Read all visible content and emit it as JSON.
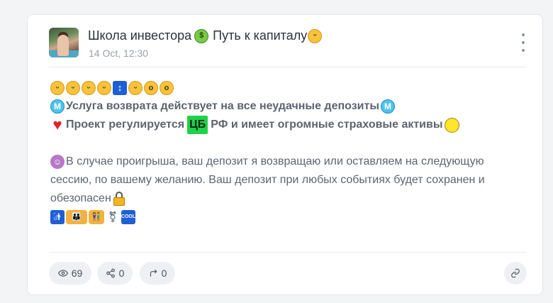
{
  "post": {
    "channel_title": "Школа инвестора 🤑 Путь к капиталу😋",
    "channel_title_text": "Школа инвестора",
    "channel_title_text2": "Путь к капиталу",
    "timestamp": "14 Oct, 12:30",
    "avatar_icon": "avatar-photo",
    "menu_icon": "more-vertical-icon"
  },
  "content": {
    "line1_emojis": [
      "😀",
      "😃",
      "😁",
      "🙂",
      "↕",
      "😋",
      "😮",
      "😦"
    ],
    "line2_text": "Услуга возврата действует на все неудачные депозиты",
    "line3_text_before": "Проект регулируется",
    "line3_highlight": "ЦБ",
    "line3_text_after": "РФ и имеет огромные страховые активы",
    "para1": "В случае проигрыша, ваш депозит я возвращаю или оставляем на следующую сессию, по вашему желанию. Ваш депозит при любых событиях будет сохранен и обезопасен",
    "last_line_emojis": [
      "🚮",
      "👨‍👩‍👧",
      "👫",
      "⚧",
      "🆒"
    ],
    "highlight_color": "#21d04b"
  },
  "footer": {
    "views": "69",
    "shares": "0",
    "forwards": "0",
    "views_icon": "eye-icon",
    "shares_icon": "share-nodes-icon",
    "forwards_icon": "forward-arrow-icon",
    "link_icon": "link-icon"
  }
}
